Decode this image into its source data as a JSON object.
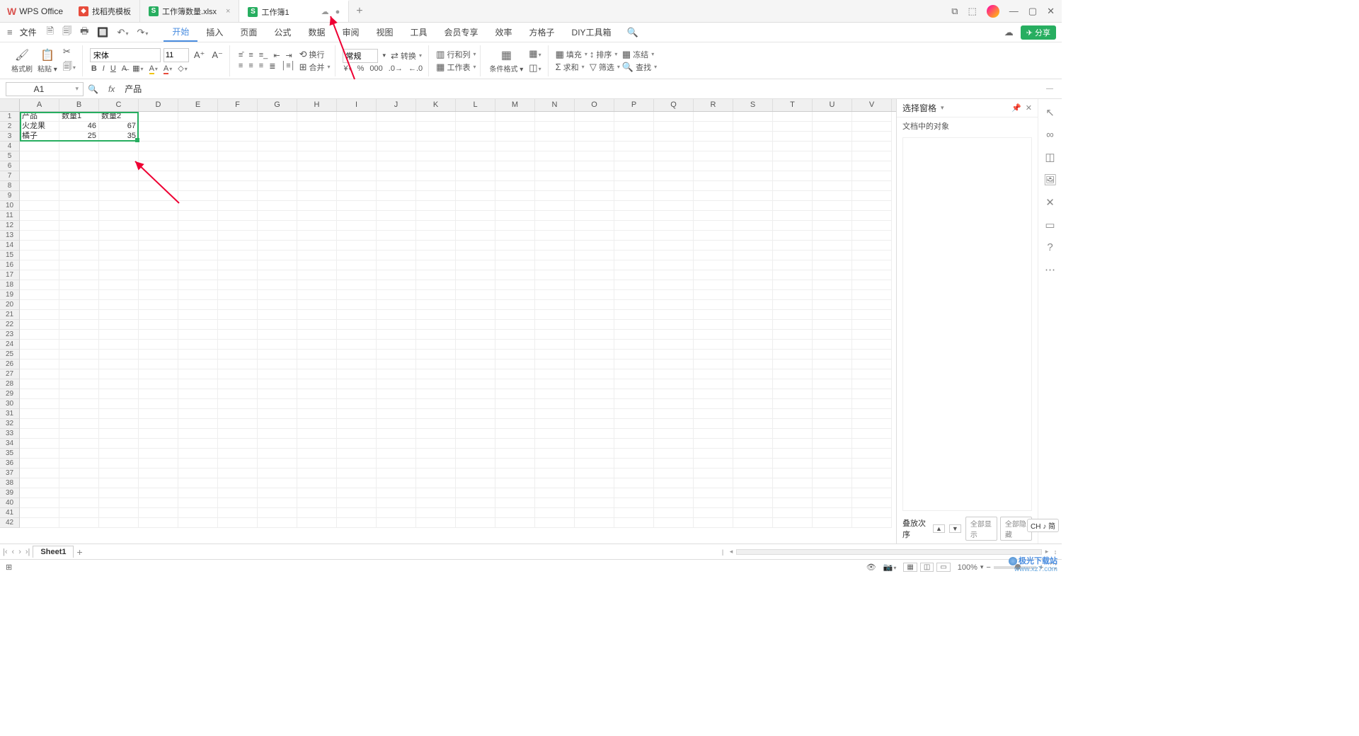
{
  "titlebar": {
    "app_name": "WPS Office",
    "tabs": [
      {
        "label": "找稻壳模板",
        "icon": "red"
      },
      {
        "label": "工作簿数量.xlsx",
        "icon": "green"
      },
      {
        "label": "工作簿1",
        "icon": "green",
        "active": true
      }
    ],
    "add": "+"
  },
  "menu": {
    "file": "文件",
    "items": [
      "开始",
      "插入",
      "页面",
      "公式",
      "数据",
      "审阅",
      "视图",
      "工具",
      "会员专享",
      "效率",
      "方格子",
      "DIY工具箱"
    ],
    "active_index": 0,
    "share": "分享"
  },
  "ribbon": {
    "format_painter": "格式刷",
    "paste": "粘贴",
    "font_name": "宋体",
    "font_size": "11",
    "wrap": "换行",
    "merge": "合并",
    "number_format": "常规",
    "convert": "转换",
    "rows_cols": "行和列",
    "worksheet": "工作表",
    "cond_format": "条件格式",
    "fill": "填充",
    "sort": "排序",
    "freeze": "冻结",
    "sum": "求和",
    "filter": "筛选",
    "find": "查找"
  },
  "formula_bar": {
    "cell_ref": "A1",
    "fx": "fx",
    "value": "产品"
  },
  "columns": [
    "A",
    "B",
    "C",
    "D",
    "E",
    "F",
    "G",
    "H",
    "I",
    "J",
    "K",
    "L",
    "M",
    "N",
    "O",
    "P",
    "Q",
    "R",
    "S",
    "T",
    "U",
    "V"
  ],
  "row_count": 42,
  "cells": {
    "A1": "产品",
    "B1": "数量1",
    "C1": "数量2",
    "A2": "火龙果",
    "B2": "46",
    "C2": "67",
    "A3": "橘子",
    "B3": "25",
    "C3": "35"
  },
  "side_pane": {
    "title": "选择窗格",
    "subtitle": "文档中的对象",
    "stack_order": "叠放次序",
    "show_all": "全部显示",
    "hide_all": "全部隐藏"
  },
  "sheet_bar": {
    "sheet_name": "Sheet1"
  },
  "status_bar": {
    "zoom": "100%",
    "lang_badge": "CH ♪ 简"
  },
  "watermark": {
    "brand": "极光下载站",
    "url": "www.xz7.com"
  }
}
